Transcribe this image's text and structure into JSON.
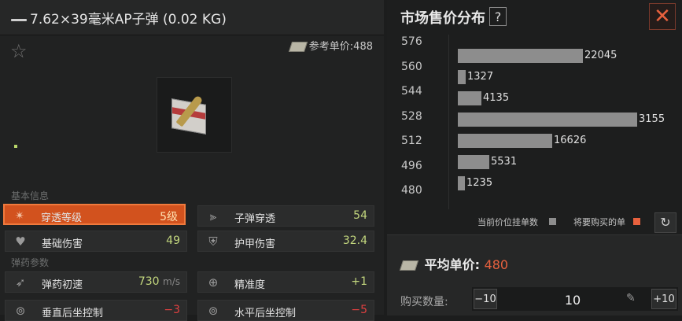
{
  "item": {
    "title": "7.62×39毫米AP子弹 (0.02 KG)",
    "ref_price_label": "参考单价:",
    "ref_price_value": "488"
  },
  "sections": {
    "basic": "基本信息",
    "ammo": "弹药参数"
  },
  "stats": [
    {
      "name": "穿透等级",
      "value": "5级",
      "icon": "penetration-icon",
      "highlighted": true
    },
    {
      "name": "子弹穿透",
      "value": "54",
      "icon": "bullet-penetration-icon"
    },
    {
      "name": "基础伤害",
      "value": "49",
      "icon": "broken-heart-icon"
    },
    {
      "name": "护甲伤害",
      "value": "32.4",
      "icon": "armor-damage-icon"
    },
    {
      "name": "弹药初速",
      "value": "730",
      "unit": "m/s",
      "icon": "bullet-speed-icon"
    },
    {
      "name": "精准度",
      "value": "+1",
      "icon": "crosshair-icon"
    },
    {
      "name": "垂直后坐控制",
      "value": "−3",
      "icon": "vertical-recoil-icon"
    },
    {
      "name": "水平后坐控制",
      "value": "−5",
      "icon": "horizontal-recoil-icon"
    }
  ],
  "market": {
    "title": "市场售价分布",
    "help": "?",
    "close": "✕",
    "legend_current": "当前价位挂单数",
    "legend_buy": "将要购买的单",
    "avg_label": "平均单价:",
    "avg_value": "480",
    "qty_label": "购买数量:",
    "qty_minus": "−10",
    "qty_plus": "+10",
    "qty_value": "10"
  },
  "colors": {
    "accent_orange": "#e8613e",
    "highlight_bg": "#d2521e",
    "bar_gray": "#8d8d8d",
    "value_green": "#c3d77e",
    "value_red": "#e04040"
  },
  "chart_data": {
    "type": "bar",
    "orientation": "horizontal",
    "categories": [
      "576",
      "560",
      "544",
      "528",
      "512",
      "496",
      "480"
    ],
    "values": [
      22045,
      1327,
      4135,
      null,
      31550,
      16626,
      5531,
      1235
    ],
    "labels": [
      "22045",
      "1327",
      "4135",
      "3155",
      "16626",
      "5531",
      "1235"
    ],
    "rows": [
      {
        "price": null,
        "value": 22045,
        "label": "22045"
      },
      {
        "price": "576",
        "value": 22045,
        "label": "22045"
      }
    ],
    "bars": [
      {
        "value": 22045,
        "label": "22045"
      },
      {
        "value": 1327,
        "label": "1327"
      },
      {
        "value": 4135,
        "label": "4135"
      },
      {
        "value": 31550,
        "label": "3155"
      },
      {
        "value": 16626,
        "label": "16626"
      },
      {
        "value": 5531,
        "label": "5531"
      },
      {
        "value": 1235,
        "label": "1235"
      }
    ],
    "ticks": [
      "576",
      "560",
      "544",
      "528",
      "512",
      "496",
      "480"
    ],
    "xlim": [
      0,
      31550
    ]
  }
}
